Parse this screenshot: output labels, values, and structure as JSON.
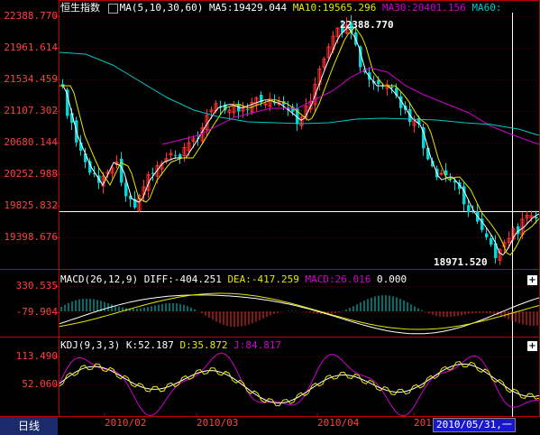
{
  "main": {
    "title": "恒生指数",
    "ma_label": "MA(5,10,30,60)",
    "ma5": "MA5:19429.044",
    "ma10": "MA10:19565.296",
    "ma30": "MA30:20401.156",
    "ma60": "MA60:",
    "y_ticks": [
      "22388.770",
      "21961.614",
      "21534.459",
      "21107.302",
      "20680.144",
      "20252.988",
      "19825.832",
      "19398.676"
    ],
    "high_annotation": "22388.770",
    "low_annotation": "18971.520"
  },
  "macd": {
    "label": "MACD(26,12,9)",
    "diff": "DIFF:-404.251",
    "dea": "DEA:-417.259",
    "macd": "MACD:26.016",
    "extra": "0.000",
    "y_ticks": [
      "330.535",
      "-79.904"
    ]
  },
  "kdj": {
    "label": "KDJ(9,3,3)",
    "k": "K:52.187",
    "d": "D:35.872",
    "j": "J:84.817",
    "y_ticks": [
      "113.490",
      "52.060"
    ]
  },
  "footer": {
    "tab_label": "日线",
    "x_ticks": [
      "2010/02",
      "2010/03",
      "2010/04",
      "201"
    ],
    "cursor_date": "2010/05/31,一"
  },
  "colors": {
    "frame": "#c00000",
    "up": "#ff3030",
    "down": "#00d8d8",
    "ma5": "#ffffff",
    "ma10": "#e8e800",
    "ma30": "#d000d0",
    "ma60": "#00c8c8"
  },
  "icons": [
    "plus-icon",
    "plus-icon"
  ]
}
